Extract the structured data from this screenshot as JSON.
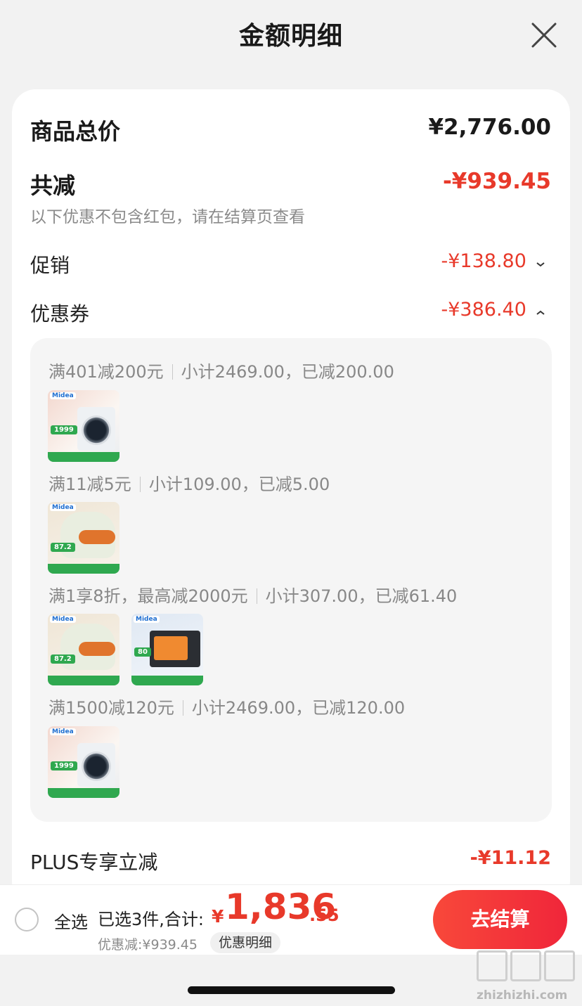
{
  "header": {
    "title": "金额明细"
  },
  "summary": {
    "goods_total_label": "商品总价",
    "goods_total_value": "¥2,776.00",
    "total_reduce_label": "共减",
    "total_reduce_value": "-¥939.45",
    "note": "以下优惠不包含红包，请在结算页查看"
  },
  "promotion": {
    "label": "促销",
    "value": "-¥138.80"
  },
  "coupon": {
    "label": "优惠券",
    "value": "-¥386.40",
    "groups": [
      {
        "rule": "满401减200元",
        "subtotal": "小计2469.00，已减200.00",
        "products": [
          "washer"
        ]
      },
      {
        "rule": "满11减5元",
        "subtotal": "小计109.00，已减5.00",
        "products": [
          "cooker"
        ]
      },
      {
        "rule": "满1享8折，最高减2000元",
        "subtotal": "小计307.00，已减61.40",
        "products": [
          "cooker",
          "oven"
        ]
      },
      {
        "rule": "满1500减120元",
        "subtotal": "小计2469.00，已减120.00",
        "products": [
          "washer"
        ]
      }
    ]
  },
  "plus": {
    "label": "PLUS专享立减",
    "value": "-¥11.12"
  },
  "thumbs": {
    "washer": {
      "brand": "Midea",
      "price": "1999"
    },
    "cooker": {
      "brand": "Midea",
      "price": "87.2"
    },
    "oven": {
      "brand": "Midea",
      "price": "80"
    }
  },
  "footer": {
    "select_all": "全选",
    "selected_summary": "已选3件,合计:",
    "currency": "¥",
    "total_int": "1,836",
    "total_dec": ".55",
    "discount_note": "优惠减:¥939.45",
    "detail_chip": "优惠明细",
    "checkout": "去结算"
  },
  "watermark": {
    "text": "zhizhizhi.com"
  },
  "colors": {
    "accent": "#e8392a",
    "checkout": "#f0263a",
    "muted": "#8a8a8a"
  }
}
